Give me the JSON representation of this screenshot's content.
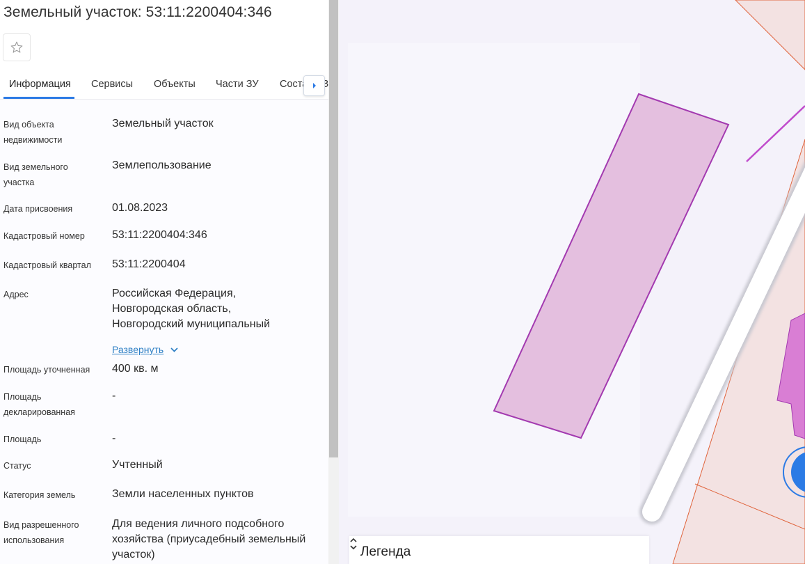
{
  "header": {
    "title": "Земельный участок: 53:11:2200404:346",
    "favorite_icon": "star-outline-icon"
  },
  "tabs": [
    {
      "label": "Информация",
      "active": true
    },
    {
      "label": "Сервисы",
      "active": false
    },
    {
      "label": "Объекты",
      "active": false
    },
    {
      "label": "Части ЗУ",
      "active": false
    },
    {
      "label": "Состав ЕЗП",
      "active": false
    }
  ],
  "tabs_next_icon": "chevron-right-icon",
  "info": {
    "rows": [
      {
        "label": "Вид объекта недвижимости",
        "value": "Земельный участок"
      },
      {
        "label": "Вид земельного участка",
        "value": "Землепользование"
      },
      {
        "label": "Дата присвоения",
        "value": "01.08.2023"
      },
      {
        "label": "Кадастровый номер",
        "value": "53:11:2200404:346"
      },
      {
        "label": "Кадастровый квартал",
        "value": "53:11:2200404"
      },
      {
        "label": "Адрес",
        "value": "Российская Федерация, Новгородская область, Новгородский муниципальный"
      },
      {
        "label": "Площадь уточненная",
        "value": "400 кв. м"
      },
      {
        "label": "Площадь декларированная",
        "value": "-"
      },
      {
        "label": "Площадь",
        "value": "-"
      },
      {
        "label": "Статус",
        "value": "Учтенный"
      },
      {
        "label": "Категория земель",
        "value": "Земли населенных пунктов"
      },
      {
        "label": "Вид разрешенного использования",
        "value": "Для ведения личного подсобного хозяйства (приусадебный земельный участок)"
      }
    ],
    "expand_label": "Развернуть"
  },
  "map": {
    "legend_label": "Легенда",
    "parcel_fill": "#e4bfdf",
    "parcel_stroke": "#a33ab0",
    "neighbor_fill": "#f3e2e2",
    "neighbor_stroke": "#e0643c",
    "accent": "#2c7be5"
  }
}
